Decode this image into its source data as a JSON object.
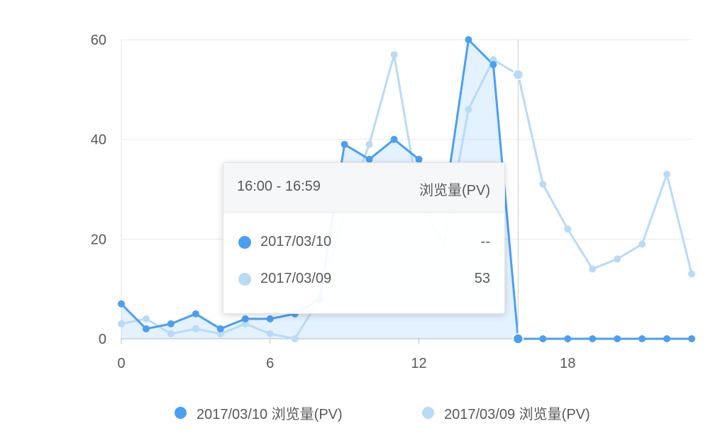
{
  "chart_data": {
    "type": "line",
    "x": [
      0,
      1,
      2,
      3,
      4,
      5,
      6,
      7,
      8,
      9,
      10,
      11,
      12,
      13,
      14,
      15,
      16,
      17,
      18,
      19,
      20,
      21,
      22,
      23
    ],
    "x_ticks": [
      0,
      6,
      12,
      18
    ],
    "x_tick_labels": [
      "0",
      "6",
      "12",
      "18"
    ],
    "ylim": [
      0,
      60
    ],
    "y_ticks": [
      0,
      20,
      40,
      60
    ],
    "y_tick_labels": [
      "0",
      "20",
      "40",
      "60"
    ],
    "grid": true,
    "legend_position": "bottom",
    "series": [
      {
        "name": "2017/03/10 浏览量(PV)",
        "color": "#4a9ff5",
        "style": "area",
        "values": [
          7,
          2,
          3,
          5,
          2,
          4,
          4,
          5,
          8,
          39,
          36,
          40,
          36,
          26,
          60,
          55,
          0,
          0,
          0,
          0,
          0,
          0,
          0,
          0
        ]
      },
      {
        "name": "2017/03/09 浏览量(PV)",
        "color": "#b8dbf8",
        "style": "line",
        "values": [
          3,
          4,
          1,
          2,
          1,
          3,
          1,
          0,
          8,
          26,
          39,
          57,
          28,
          19,
          46,
          56,
          53,
          31,
          22,
          14,
          16,
          19,
          33,
          13
        ]
      }
    ],
    "crosshair_x": 16
  },
  "tooltip": {
    "title": "16:00 - 16:59",
    "metric": "浏览量(PV)",
    "rows": [
      {
        "name": "2017/03/10",
        "value": "--",
        "color": "#4a9ff5"
      },
      {
        "name": "2017/03/09",
        "value": "53",
        "color": "#b8dbf8"
      }
    ]
  },
  "legend": [
    {
      "label": "2017/03/10 浏览量(PV)",
      "color": "#4a9ff5"
    },
    {
      "label": "2017/03/09 浏览量(PV)",
      "color": "#b8dbf8"
    }
  ]
}
